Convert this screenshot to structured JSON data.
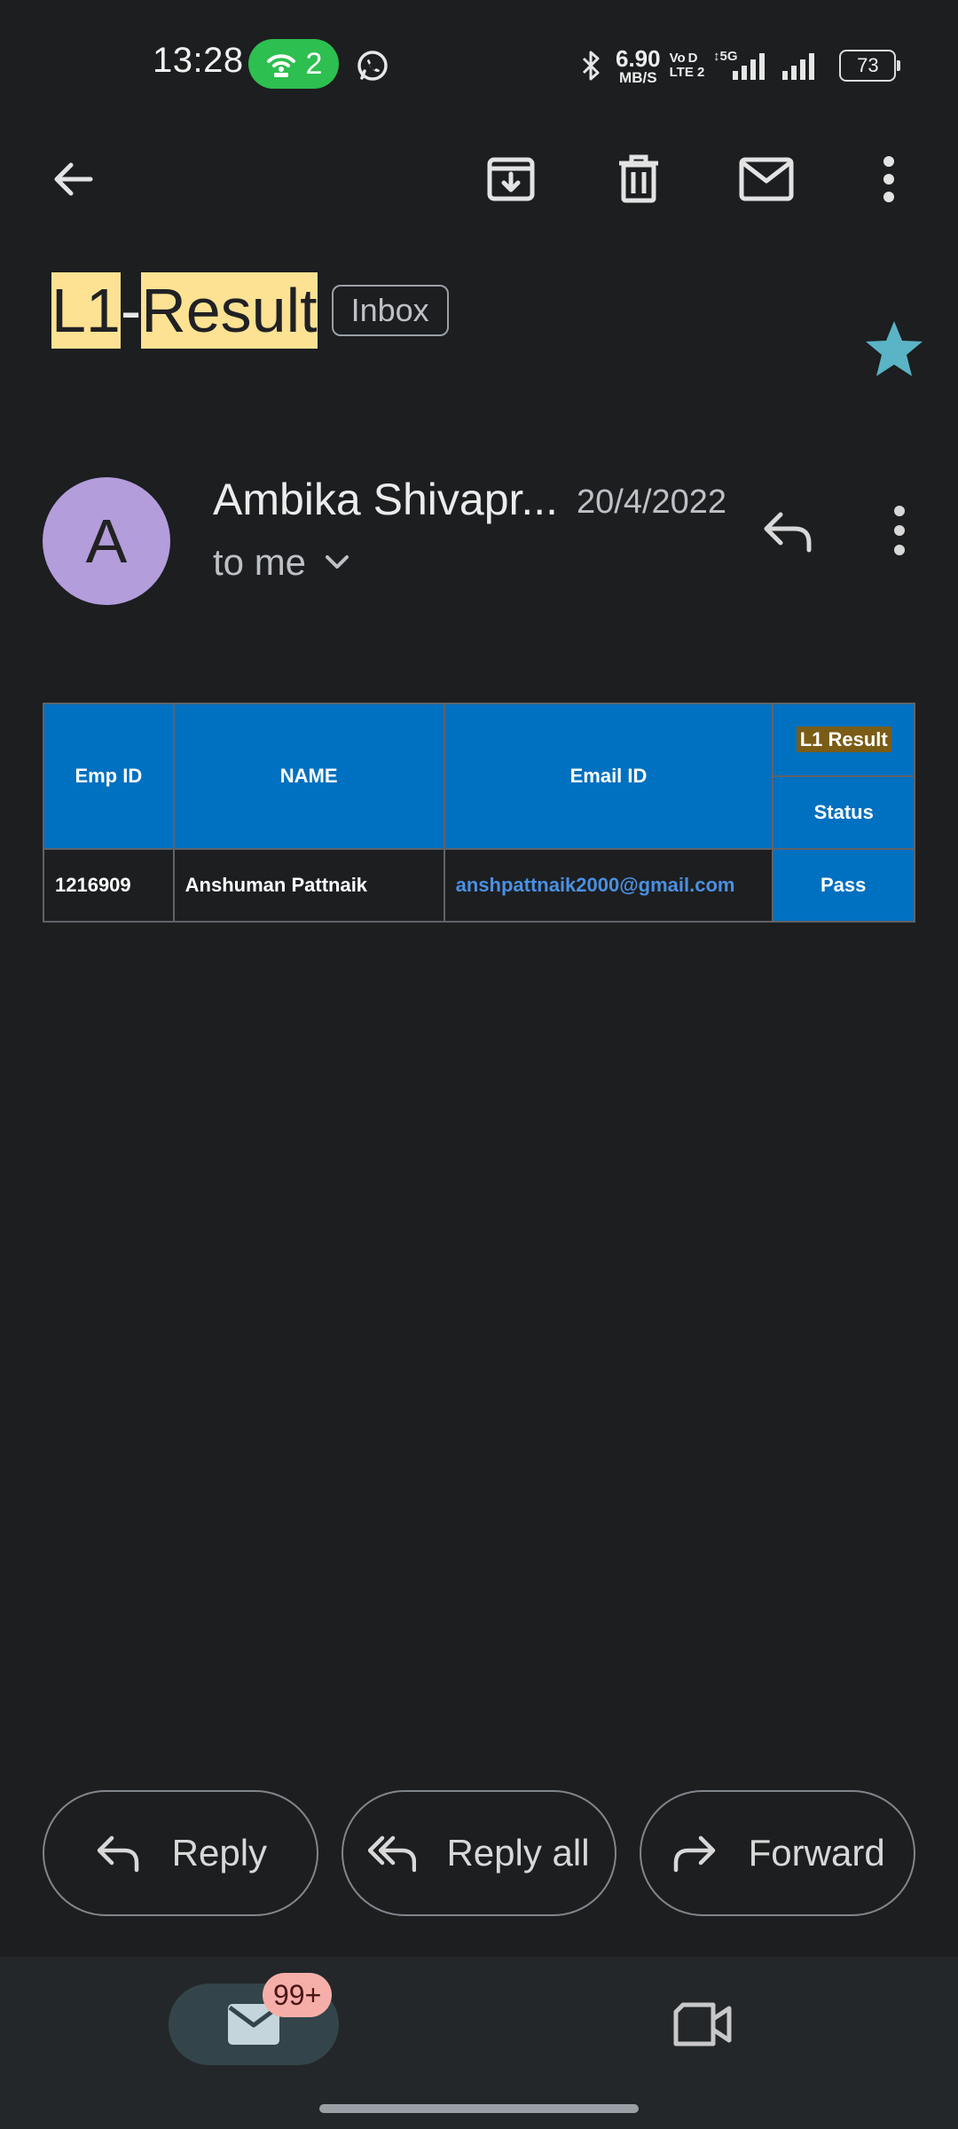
{
  "status_bar": {
    "time": "13:28",
    "hotspot_count": "2",
    "net_speed_value": "6.90",
    "net_speed_unit": "MB/S",
    "volte_line1": "Vo D",
    "volte_line2": "LTE 2",
    "network_type": "5G",
    "battery": "73"
  },
  "email": {
    "subject_part1": "L1",
    "subject_sep": "-",
    "subject_part2": "Result",
    "label": "Inbox",
    "sender_initial": "A",
    "sender_name": "Ambika Shivapr...",
    "date": "20/4/2022",
    "recipient": "to me"
  },
  "table": {
    "headers": {
      "emp_id": "Emp ID",
      "name": "NAME",
      "email": "Email ID",
      "l1_result": "L1 Result",
      "status": "Status"
    },
    "rows": [
      {
        "emp_id": "1216909",
        "name": "Anshuman Pattnaik",
        "email": "anshpattnaik2000@gmail.com",
        "status": "Pass"
      }
    ]
  },
  "actions": {
    "reply": "Reply",
    "reply_all": "Reply all",
    "forward": "Forward"
  },
  "bottom_nav": {
    "mail_badge": "99+"
  },
  "colors": {
    "background": "#1c1e20",
    "table_header": "#0070c0",
    "highlight": "#fde293",
    "star": "#5ab4c5",
    "avatar": "#b39ddb",
    "link": "#4a90e2"
  }
}
